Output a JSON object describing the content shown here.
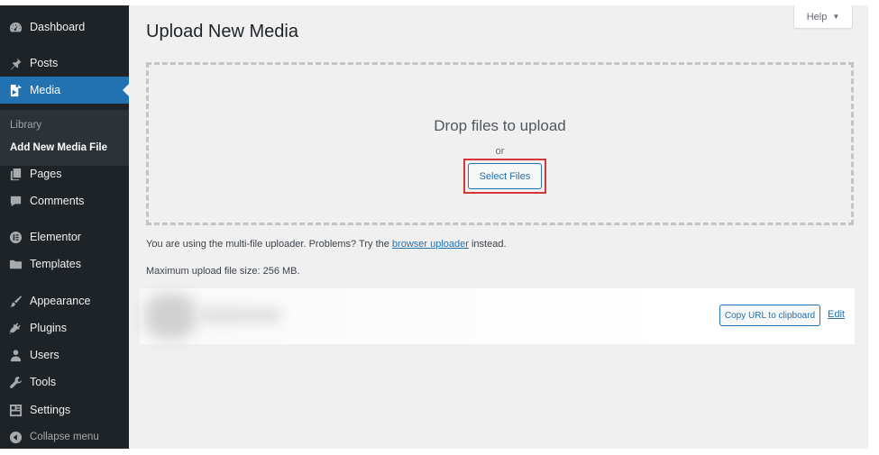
{
  "sidebar": {
    "items": [
      {
        "label": "Dashboard",
        "icon": "dashboard-icon"
      },
      {
        "label": "Posts",
        "icon": "pin-icon"
      },
      {
        "label": "Media",
        "icon": "media-icon",
        "active": true
      },
      {
        "label": "Pages",
        "icon": "pages-icon"
      },
      {
        "label": "Comments",
        "icon": "comment-icon"
      },
      {
        "label": "Elementor",
        "icon": "elementor-icon"
      },
      {
        "label": "Templates",
        "icon": "folder-icon"
      },
      {
        "label": "Appearance",
        "icon": "brush-icon"
      },
      {
        "label": "Plugins",
        "icon": "plug-icon"
      },
      {
        "label": "Users",
        "icon": "users-icon"
      },
      {
        "label": "Tools",
        "icon": "wrench-icon"
      },
      {
        "label": "Settings",
        "icon": "settings-icon"
      }
    ],
    "submenu": {
      "library": "Library",
      "add_new": "Add New Media File"
    },
    "collapse": "Collapse menu"
  },
  "header": {
    "help": "Help",
    "help_arrow": "▼",
    "title": "Upload New Media"
  },
  "uploader": {
    "drop_text": "Drop files to upload",
    "or_text": "or",
    "select_button": "Select Files",
    "info_prefix": "You are using the multi-file uploader. Problems? Try the",
    "info_link": "browser uploader",
    "info_suffix": "instead.",
    "max_size": "Maximum upload file size: 256 MB."
  },
  "media_item": {
    "copy_button": "Copy URL to clipboard",
    "edit_link": "Edit"
  },
  "colors": {
    "sidebar_bg": "#1d2327",
    "accent": "#2271b1",
    "highlight_border": "#d63638",
    "content_bg": "#f0f0f1"
  }
}
